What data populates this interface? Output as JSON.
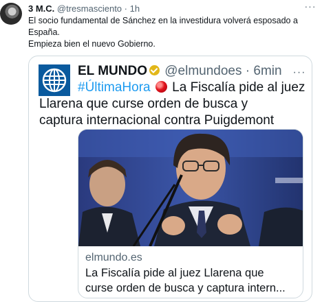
{
  "tweet": {
    "author_name": "3 M.C.",
    "author_handle": "@tresmasciento",
    "separator": "·",
    "time": "1h",
    "more": "···",
    "text_lines": [
      "El socio fundamental de Sánchez en la investidura volverá esposado a",
      "España.",
      "Empieza bien el nuevo Gobierno."
    ]
  },
  "quote": {
    "name": "EL MUNDO",
    "handle": "@elmundoes",
    "separator": "·",
    "time": "6min",
    "more": "···",
    "hashtag": "#ÚltimaHora",
    "text_line1": "La Fiscalía pide al juez",
    "text_line2": "Llarena que curse orden de busca y",
    "text_line3": "captura internacional contra Puigdemont",
    "card": {
      "domain": "elmundo.es",
      "title_line1": "La Fiscalía pide al juez Llarena que",
      "title_line2": "curse orden de busca y captura intern..."
    }
  },
  "colors": {
    "link_blue": "#1d9bf0",
    "secondary_text": "#536471",
    "verified_gold": "#e2b719",
    "elmundo_blue": "#0a5a9e",
    "border": "#cfd9de"
  },
  "icons": [
    "avatar",
    "more-icon",
    "elmundo-logo",
    "verified-badge-icon",
    "red-circle-emoji"
  ]
}
